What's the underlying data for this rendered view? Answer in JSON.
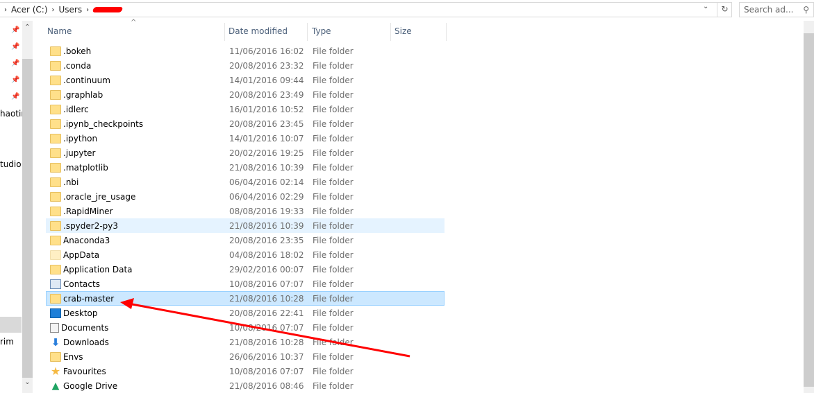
{
  "address": {
    "crumbs": [
      "Acer (C:)",
      "Users"
    ],
    "refresh_icon": "refresh-icon"
  },
  "search": {
    "placeholder": "Search ad..."
  },
  "left_pane": {
    "partial_labels": [
      "haotin",
      "tudio",
      "rim"
    ]
  },
  "columns": [
    "Name",
    "Date modified",
    "Type",
    "Size"
  ],
  "files": [
    {
      "name": ".bokeh",
      "date": "11/06/2016 16:02",
      "type": "File folder",
      "icon": "folder"
    },
    {
      "name": ".conda",
      "date": "20/08/2016 23:32",
      "type": "File folder",
      "icon": "folder"
    },
    {
      "name": ".continuum",
      "date": "14/01/2016 09:44",
      "type": "File folder",
      "icon": "folder"
    },
    {
      "name": ".graphlab",
      "date": "20/08/2016 23:49",
      "type": "File folder",
      "icon": "folder"
    },
    {
      "name": ".idlerc",
      "date": "16/01/2016 10:52",
      "type": "File folder",
      "icon": "folder"
    },
    {
      "name": ".ipynb_checkpoints",
      "date": "20/08/2016 23:45",
      "type": "File folder",
      "icon": "folder"
    },
    {
      "name": ".ipython",
      "date": "14/01/2016 10:07",
      "type": "File folder",
      "icon": "folder"
    },
    {
      "name": ".jupyter",
      "date": "20/02/2016 19:25",
      "type": "File folder",
      "icon": "folder"
    },
    {
      "name": ".matplotlib",
      "date": "21/08/2016 10:39",
      "type": "File folder",
      "icon": "folder"
    },
    {
      "name": ".nbi",
      "date": "06/04/2016 02:14",
      "type": "File folder",
      "icon": "folder"
    },
    {
      "name": ".oracle_jre_usage",
      "date": "06/04/2016 02:29",
      "type": "File folder",
      "icon": "folder"
    },
    {
      "name": ".RapidMiner",
      "date": "08/08/2016 19:33",
      "type": "File folder",
      "icon": "folder"
    },
    {
      "name": ".spyder2-py3",
      "date": "21/08/2016 10:39",
      "type": "File folder",
      "icon": "folder",
      "state": "hover"
    },
    {
      "name": "Anaconda3",
      "date": "20/08/2016 23:35",
      "type": "File folder",
      "icon": "folder"
    },
    {
      "name": "AppData",
      "date": "04/08/2016 18:02",
      "type": "File folder",
      "icon": "folder-hidden"
    },
    {
      "name": "Application Data",
      "date": "29/02/2016 00:07",
      "type": "File folder",
      "icon": "folder"
    },
    {
      "name": "Contacts",
      "date": "10/08/2016 07:07",
      "type": "File folder",
      "icon": "contacts"
    },
    {
      "name": "crab-master",
      "date": "21/08/2016 10:28",
      "type": "File folder",
      "icon": "folder",
      "state": "selected"
    },
    {
      "name": "Desktop",
      "date": "20/08/2016 22:41",
      "type": "File folder",
      "icon": "desktop"
    },
    {
      "name": "Documents",
      "date": "10/08/2016 07:07",
      "type": "File folder",
      "icon": "documents"
    },
    {
      "name": "Downloads",
      "date": "21/08/2016 10:28",
      "type": "File folder",
      "icon": "downloads"
    },
    {
      "name": "Envs",
      "date": "26/06/2016 10:37",
      "type": "File folder",
      "icon": "folder"
    },
    {
      "name": "Favourites",
      "date": "10/08/2016 07:07",
      "type": "File folder",
      "icon": "star"
    },
    {
      "name": "Google Drive",
      "date": "21/08/2016 08:46",
      "type": "File folder",
      "icon": "google-drive"
    }
  ],
  "annotation_color": "#ff0000"
}
